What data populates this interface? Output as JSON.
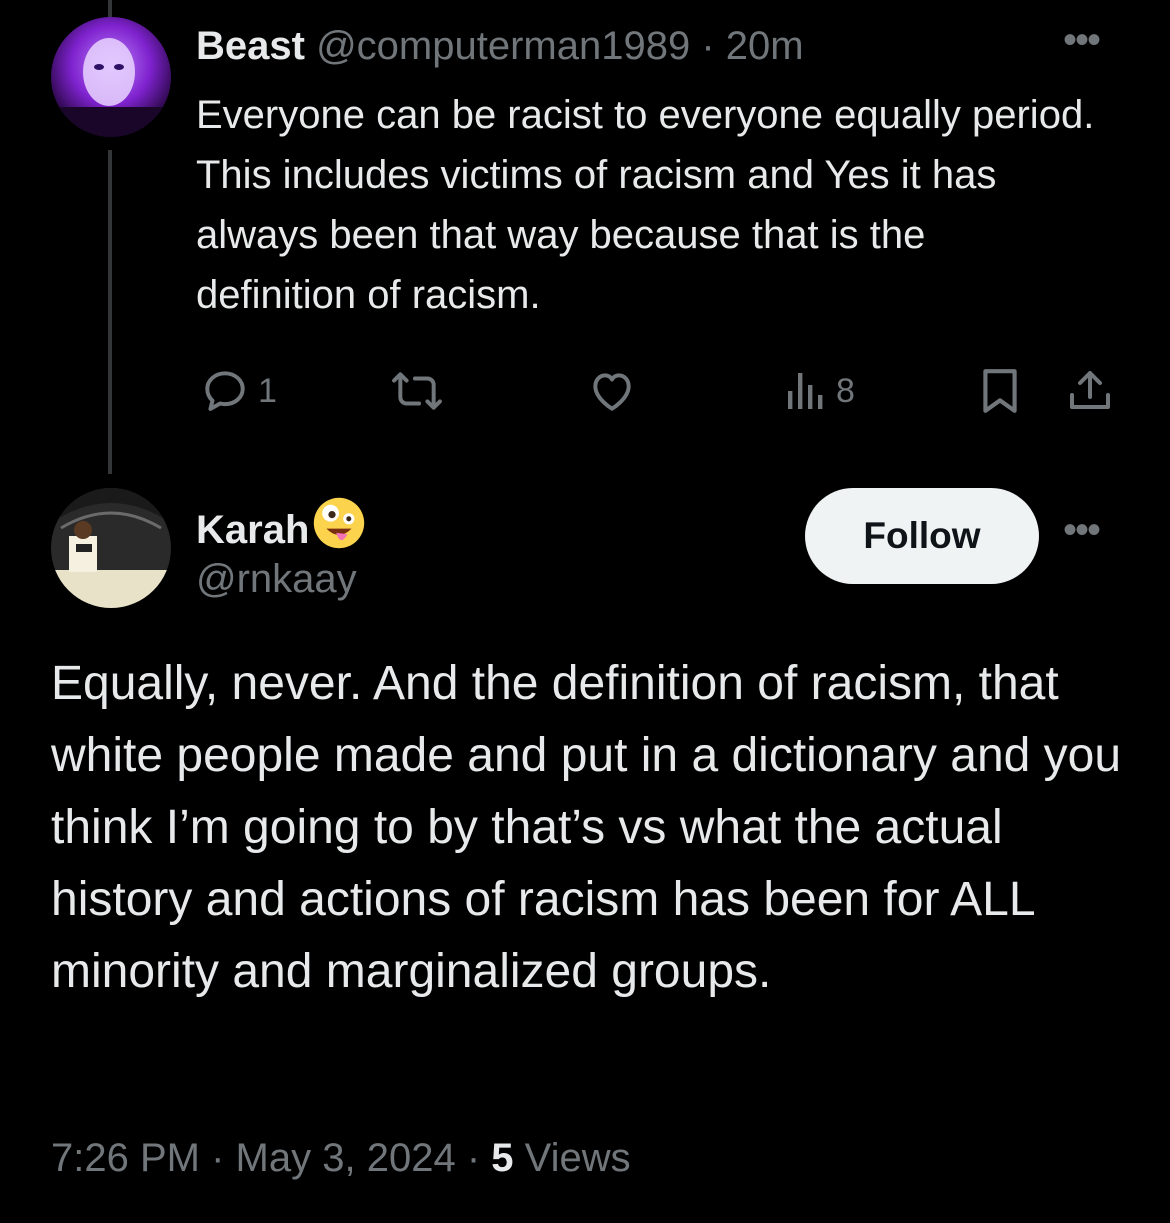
{
  "tweet1": {
    "display_name": "Beast",
    "handle": "@computerman1989",
    "separator": "·",
    "time": "20m",
    "text": "Everyone can be racist to everyone equally period. This includes victims of racism and Yes it has always been that way because that is the definition of racism.",
    "more_icon": "more-horizontal-icon",
    "actions": {
      "reply_count": "1",
      "views_count": "8"
    }
  },
  "tweet2": {
    "display_name": "Karah",
    "emoji": "zany-face",
    "handle": "@rnkaay",
    "follow_label": "Follow",
    "text": "Equally, never. And the definition of racism, that white people made and put in a dictionary and you think I’m going to by that’s vs what the actual history and actions of racism has been for ALL minority and marginalized groups.",
    "timestamp": "7:26 PM",
    "date": "May 3, 2024",
    "separator": "·",
    "views_count": "5",
    "views_label": "Views"
  },
  "colors": {
    "background": "#000000",
    "text": "#e7e9ea",
    "muted": "#71767b",
    "follow_bg": "#eff3f4"
  }
}
